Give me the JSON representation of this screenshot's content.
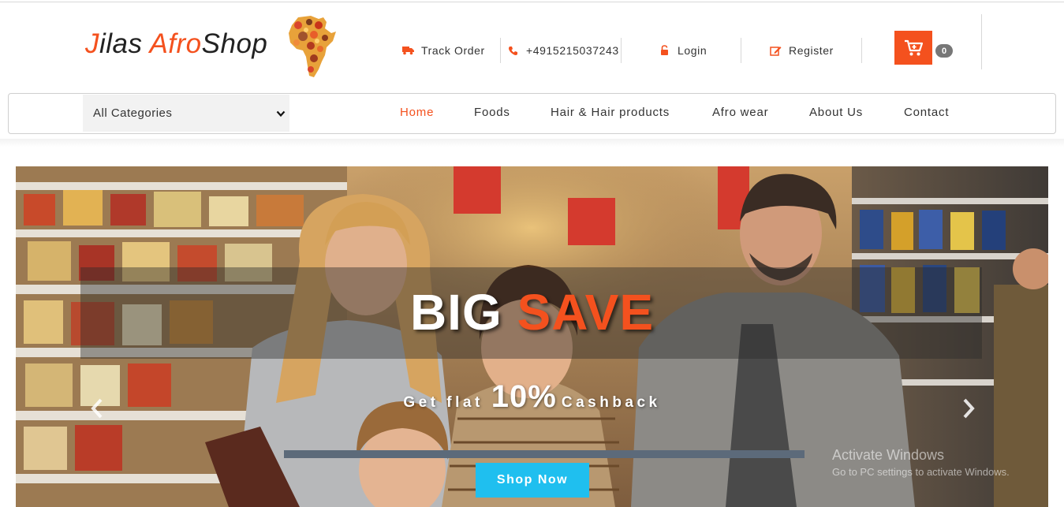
{
  "brand": {
    "logo_j": "J",
    "logo_ilas": "ilas ",
    "logo_afro": "Afro",
    "logo_shop": "Shop",
    "accent_color": "#f4511e"
  },
  "header_links": {
    "track_order": {
      "label": "Track Order",
      "icon": "truck-icon"
    },
    "phone": {
      "label": "+4915215037243",
      "icon": "phone-icon"
    },
    "login": {
      "label": "Login",
      "icon": "lock-icon"
    },
    "register": {
      "label": "Register",
      "icon": "edit-icon"
    }
  },
  "cart": {
    "count": "0",
    "icon": "cart-icon"
  },
  "nav": {
    "category_select": "All Categories",
    "items": [
      {
        "label": "Home",
        "active": true
      },
      {
        "label": "Foods"
      },
      {
        "label": "Hair & Hair products"
      },
      {
        "label": "Afro wear"
      },
      {
        "label": "About Us"
      },
      {
        "label": "Contact"
      }
    ]
  },
  "hero": {
    "headline_big": "BIG ",
    "headline_save": "SAVE",
    "sub_before": "Get flat",
    "sub_pct": "10%",
    "sub_after": "Cashback",
    "button_label": "Shop Now",
    "button_color": "#1fbfef"
  },
  "watermark": {
    "line1": "Activate Windows",
    "line2": "Go to PC settings to activate Windows."
  }
}
